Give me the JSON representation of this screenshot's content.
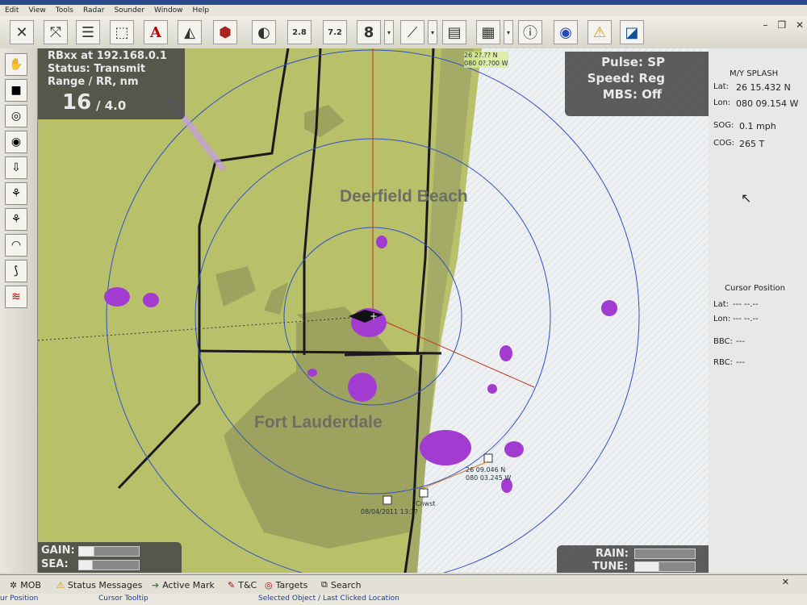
{
  "menu": [
    "Edit",
    "View",
    "Tools",
    "Radar",
    "Sounder",
    "Window",
    "Help"
  ],
  "toolbar": {
    "icons": [
      "crosshair-icon",
      "route-icon",
      "layers-icon",
      "select-icon",
      "text-icon",
      "chart-icon",
      "overlay-icon",
      "3d-icon",
      "measure-icon",
      "tool-icon",
      "waypoint-icon",
      "split-icon",
      "page-icon",
      "page2-icon",
      "info-icon",
      "globe-icon",
      "warning-icon",
      "logo-icon"
    ],
    "range_btn_1": "2.8",
    "range_btn_2": "7.2",
    "zoom_value": "8"
  },
  "radar": {
    "source": "RBxx at 192.168.0.1",
    "status": "Status: Transmit",
    "range_label": "Range / RR, nm",
    "range": "16",
    "ring_range": "/ 4.0",
    "pulse": "Pulse: SP",
    "speed": "Speed: Reg",
    "mbs": "MBS: Off",
    "gain_label": "GAIN:",
    "sea_label": "SEA:",
    "rain_label": "RAIN:",
    "tune_label": "TUNE:"
  },
  "map_labels": {
    "city1": "Deerfield Beach",
    "city2": "Fort Lauderdale",
    "top_coord_1": "26 2?.?? N",
    "top_coord_2": "080 0?.?00 W",
    "mark_coord_1": "26 09.046 N",
    "mark_coord_2": "080 03.245 W",
    "mark_date": "08/04/2011 13:1?",
    "marker_label": "Cnwst"
  },
  "vessel": {
    "name": "M/Y SPLASH",
    "lat_label": "Lat:",
    "lat": "26 15.432 N",
    "lon_label": "Lon:",
    "lon": "080 09.154 W",
    "sog_label": "SOG:",
    "sog": "0.1 mph",
    "cog_label": "COG:",
    "cog": "265 T"
  },
  "cursor": {
    "title": "Cursor Position",
    "lat_label": "Lat:",
    "lat": "--- --.--",
    "lon_label": "Lon:",
    "lon": "--- --.--",
    "bbc_label": "BBC:",
    "bbc": "---",
    "rbc_label": "RBC:",
    "rbc": "---"
  },
  "bottom_tabs": [
    "MOB",
    "Status Messages",
    "Active Mark",
    "T&C",
    "Targets",
    "Search"
  ],
  "status": {
    "left": "ur Position",
    "tooltip": "Cursor Tooltip",
    "selected": "Selected Object / Last Clicked Location"
  }
}
